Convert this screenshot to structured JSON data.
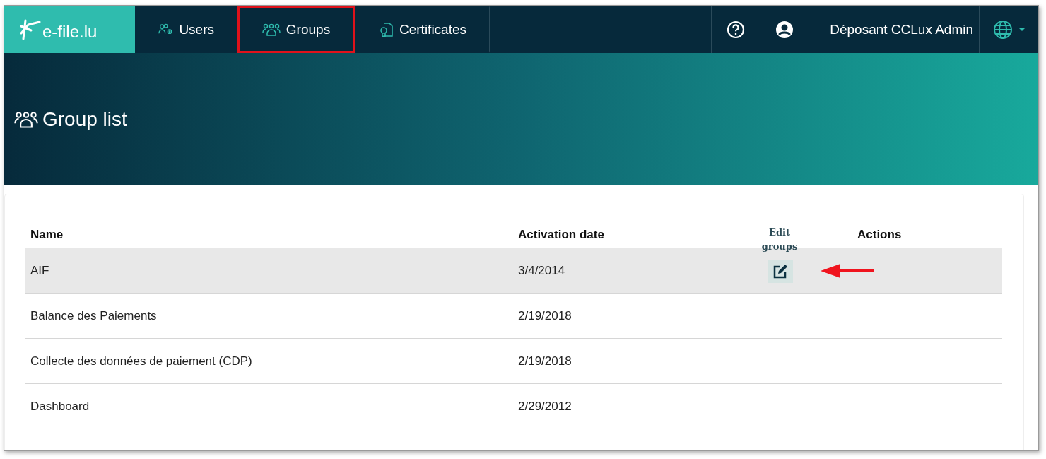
{
  "logo": {
    "text": "e-file.lu"
  },
  "nav": [
    {
      "label": "Users",
      "highlighted": false
    },
    {
      "label": "Groups",
      "highlighted": true
    },
    {
      "label": "Certificates",
      "highlighted": false
    }
  ],
  "user": {
    "name": "Déposant CCLux Admin"
  },
  "page": {
    "title": "Group list"
  },
  "table": {
    "columns": [
      "Name",
      "Activation date",
      "Actions"
    ],
    "rows": [
      {
        "name": "AIF",
        "date": "3/4/2014",
        "selected": true,
        "tooltip": "Edit groups",
        "arrow": true
      },
      {
        "name": "Balance des Paiements",
        "date": "2/19/2018",
        "selected": false
      },
      {
        "name": "Collecte des données de paiement (CDP)",
        "date": "2/19/2018",
        "selected": false
      },
      {
        "name": "Dashboard",
        "date": "2/29/2012",
        "selected": false
      }
    ]
  }
}
